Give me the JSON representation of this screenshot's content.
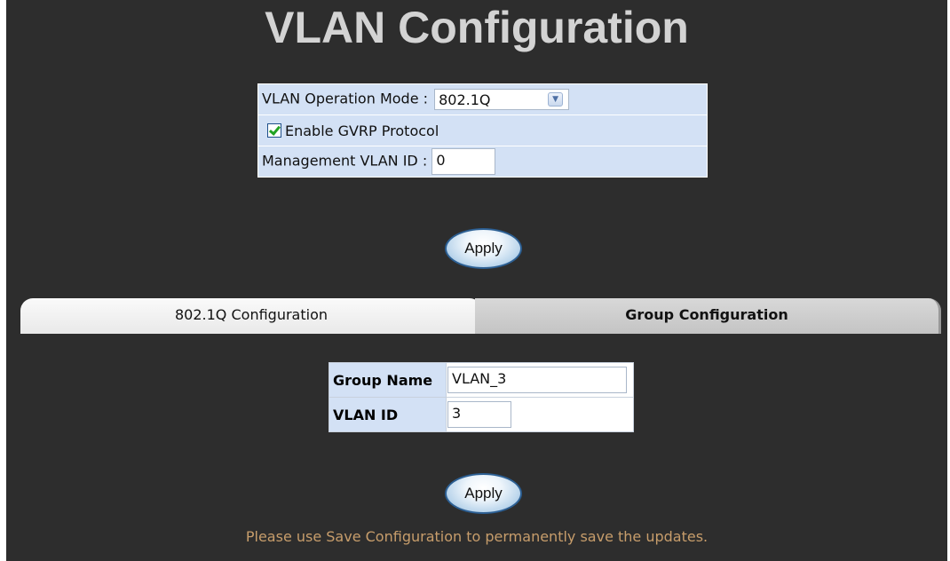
{
  "page": {
    "title": "VLAN Configuration"
  },
  "mode_settings": {
    "operation_mode_label": "VLAN Operation Mode :",
    "operation_mode_value": "802.1Q",
    "gvrp_label": "Enable GVRP Protocol",
    "gvrp_checked": true,
    "mgmt_vlan_label": "Management VLAN ID :",
    "mgmt_vlan_value": "0"
  },
  "apply_label": "Apply",
  "tabs": {
    "tab1_label": "802.1Q Configuration",
    "tab2_label": "Group Configuration",
    "active_tab": "Group Configuration"
  },
  "group_form": {
    "group_name_label": "Group Name",
    "group_name_value": "VLAN_3",
    "vlan_id_label": "VLAN ID",
    "vlan_id_value": "3"
  },
  "notice": "Please use Save Configuration to permanently save the updates.",
  "colors": {
    "background": "#2d2d2d",
    "title": "#d3d3d3",
    "panel": "#d3e1f5",
    "notice": "#c79d6b"
  }
}
